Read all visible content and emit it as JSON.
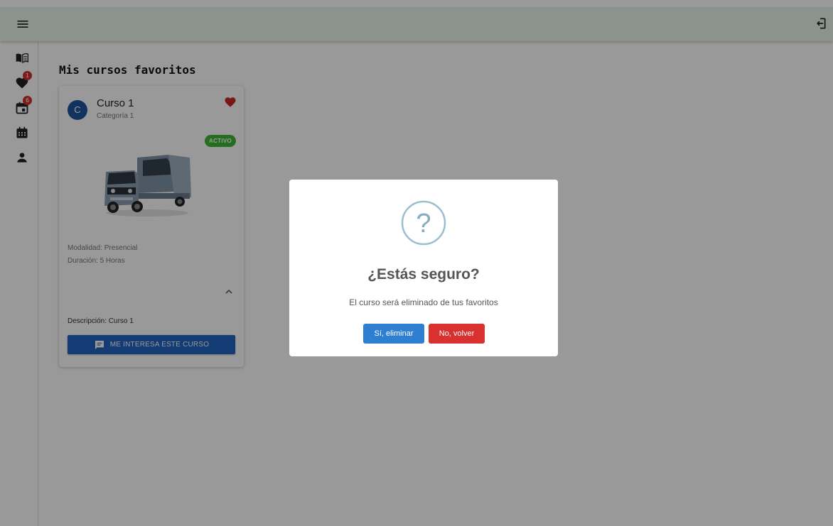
{
  "topbar": {
    "menu_icon": "menu-icon",
    "logout_icon": "logout-icon"
  },
  "sidebar": {
    "items": [
      {
        "icon": "book-icon"
      },
      {
        "icon": "heart-icon",
        "badge": "1"
      },
      {
        "icon": "calendar-event-icon",
        "badge": "6"
      },
      {
        "icon": "calendar-month-icon"
      },
      {
        "icon": "person-icon"
      }
    ]
  },
  "main": {
    "title": "Mis cursos favoritos"
  },
  "course_card": {
    "avatar_letter": "C",
    "title": "Curso 1",
    "category": "Categoría 1",
    "status": "ACTIVO",
    "modality": "Modalidad: Presencial",
    "duration": "Duración: 5 Horas",
    "description": "Descripción: Curso 1",
    "interest_button": "ME INTERESA ESTE CURSO",
    "image": "pickup-truck-image"
  },
  "dialog": {
    "icon": "question-icon",
    "title": "¿Estás seguro?",
    "text": "El curso será eliminado de tus favoritos",
    "confirm_label": "Sí, eliminar",
    "cancel_label": "No, volver"
  },
  "colors": {
    "topbar_bg": "#eaf6ea",
    "primary": "#1e64c0",
    "confirm": "#2e7fd1",
    "cancel": "#d9312f",
    "active_chip": "#3fb735",
    "badge": "#d32f2f",
    "overlay": "rgba(0,0,0,0.4)"
  }
}
